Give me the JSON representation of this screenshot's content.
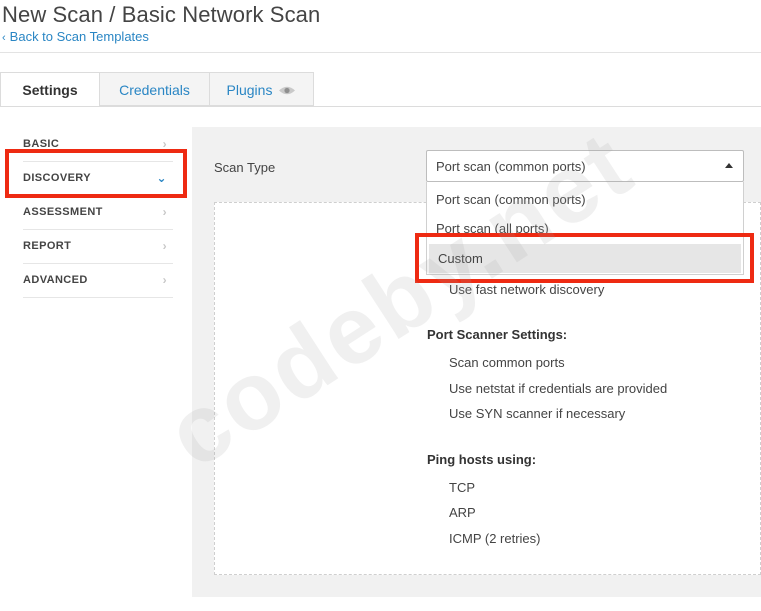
{
  "header": {
    "title": "New Scan / Basic Network Scan",
    "back_link": "Back to Scan Templates"
  },
  "tabs": [
    {
      "label": "Settings",
      "active": true
    },
    {
      "label": "Credentials",
      "active": false
    },
    {
      "label": "Plugins",
      "active": false,
      "icon": "eye-icon"
    }
  ],
  "sidebar": {
    "items": [
      {
        "label": "BASIC",
        "expanded": false
      },
      {
        "label": "DISCOVERY",
        "expanded": true
      },
      {
        "label": "ASSESSMENT",
        "expanded": false
      },
      {
        "label": "REPORT",
        "expanded": false
      },
      {
        "label": "ADVANCED",
        "expanded": false
      }
    ]
  },
  "form": {
    "scan_type_label": "Scan Type",
    "scan_type_value": "Port scan (common ports)",
    "options": [
      "Port scan (common ports)",
      "Port scan (all ports)",
      "Custom"
    ],
    "highlighted_option": "Custom",
    "partial_line": "Use fast network discovery",
    "port_scanner": {
      "heading": "Port Scanner Settings:",
      "items": [
        "Scan common ports",
        "Use netstat if credentials are provided",
        "Use SYN scanner if necessary"
      ]
    },
    "ping": {
      "heading": "Ping hosts using:",
      "items": [
        "TCP",
        "ARP",
        "ICMP (2 retries)"
      ]
    }
  },
  "watermark": "codeby.net",
  "colors": {
    "link": "#2a86c4",
    "highlight_box": "#ee2a12",
    "panel_bg": "#f1f1f1"
  }
}
